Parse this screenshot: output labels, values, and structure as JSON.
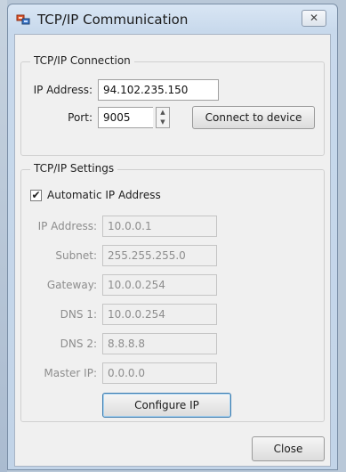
{
  "window": {
    "title": "TCP/IP Communication",
    "close_glyph": "✕"
  },
  "connection": {
    "group_title": "TCP/IP Connection",
    "ip_label": "IP Address:",
    "ip_value": "94.102.235.150",
    "port_label": "Port:",
    "port_value": "9005",
    "connect_label": "Connect to device"
  },
  "settings": {
    "group_title": "TCP/IP Settings",
    "auto_ip_label": "Automatic IP Address",
    "auto_ip_checked": true,
    "fields": [
      {
        "label": "IP Address:",
        "value": "10.0.0.1"
      },
      {
        "label": "Subnet:",
        "value": "255.255.255.0"
      },
      {
        "label": "Gateway:",
        "value": "10.0.0.254"
      },
      {
        "label": "DNS 1:",
        "value": "10.0.0.254"
      },
      {
        "label": "DNS 2:",
        "value": "8.8.8.8"
      },
      {
        "label": "Master IP:",
        "value": "0.0.0.0"
      }
    ],
    "configure_label": "Configure IP"
  },
  "footer": {
    "close_label": "Close"
  },
  "icons": {
    "app": "network-app-icon",
    "check": "checkmark-icon",
    "spin_up": "arrow-up-icon",
    "spin_down": "arrow-down-icon"
  }
}
